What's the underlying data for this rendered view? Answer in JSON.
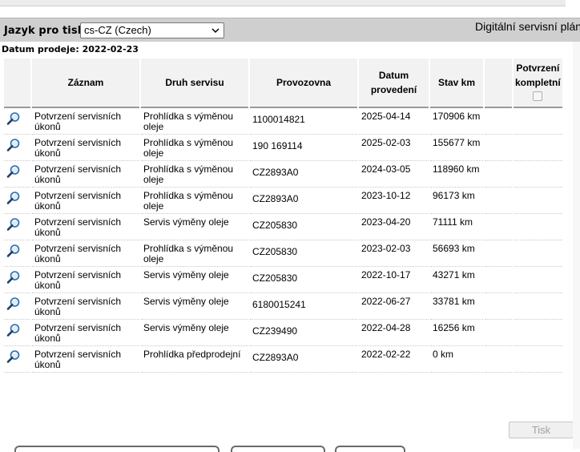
{
  "header": {
    "language_label": "Jazyk pro tisk:",
    "language_value": "cs-CZ (Czech)",
    "title": "Digitální servisní plán"
  },
  "sale_date": "Datum prodeje: 2022-02-23",
  "table": {
    "columns": {
      "record": "Záznam",
      "service_type": "Druh servisu",
      "workshop": "Provozovna",
      "date_line1": "Datum",
      "date_line2": "provedení",
      "mileage": "Stav km",
      "confirm_line1": "Potvrzení",
      "confirm_line2": "kompletní"
    },
    "rows": [
      {
        "record": "Potvrzení servisních úkonů",
        "type": "Prohlídka s výměnou oleje",
        "workshop": "1100014821",
        "date": "2025-04-14",
        "km": "170906 km"
      },
      {
        "record": "Potvrzení servisních úkonů",
        "type": "Prohlídka s výměnou oleje",
        "workshop": "190 169114",
        "date": "2025-02-03",
        "km": "155677 km"
      },
      {
        "record": "Potvrzení servisních úkonů",
        "type": "Prohlídka s výměnou oleje",
        "workshop": "CZ2893A0",
        "date": "2024-03-05",
        "km": "118960 km"
      },
      {
        "record": "Potvrzení servisních úkonů",
        "type": "Prohlídka s výměnou oleje",
        "workshop": "CZ2893A0",
        "date": "2023-10-12",
        "km": "96173 km"
      },
      {
        "record": "Potvrzení servisních úkonů",
        "type": "Servis výměny oleje",
        "workshop": "CZ205830",
        "date": "2023-04-20",
        "km": "71111 km"
      },
      {
        "record": "Potvrzení servisních úkonů",
        "type": "Prohlídka s výměnou oleje",
        "workshop": "CZ205830",
        "date": "2023-02-03",
        "km": "56693 km"
      },
      {
        "record": "Potvrzení servisních úkonů",
        "type": "Servis výměny oleje",
        "workshop": "CZ205830",
        "date": "2022-10-17",
        "km": "43271 km"
      },
      {
        "record": "Potvrzení servisních úkonů",
        "type": "Servis výměny oleje",
        "workshop": "6180015241",
        "date": "2022-06-27",
        "km": "33781 km"
      },
      {
        "record": "Potvrzení servisních úkonů",
        "type": "Servis výměny oleje",
        "workshop": "CZ239490",
        "date": "2022-04-28",
        "km": "16256 km"
      },
      {
        "record": "Potvrzení servisních úkonů",
        "type": "Prohlídka předprodejní",
        "workshop": "CZ2893A0",
        "date": "2022-02-22",
        "km": "0 km"
      }
    ]
  },
  "print_button": "Tisk",
  "icons": {
    "row_icon": "magnifier-icon",
    "select_icon": "chevron-down-icon"
  }
}
